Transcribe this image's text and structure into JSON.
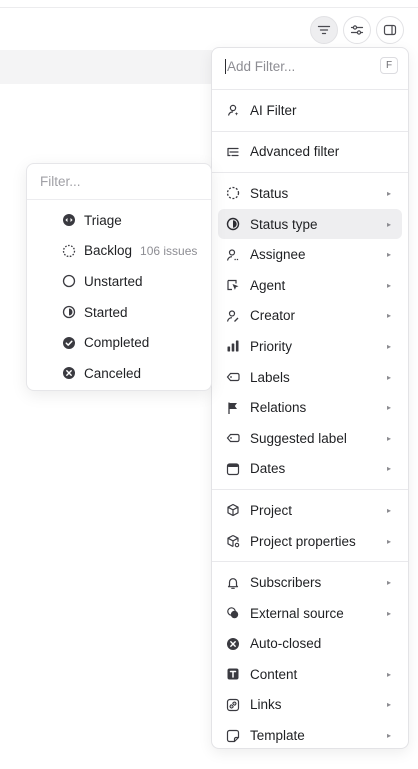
{
  "menu": {
    "search_placeholder": "Add Filter...",
    "search_shortcut": "F",
    "ai_filter": "AI Filter",
    "advanced_filter": "Advanced filter",
    "group1": [
      {
        "label": "Status"
      },
      {
        "label": "Status type"
      },
      {
        "label": "Assignee"
      },
      {
        "label": "Agent"
      },
      {
        "label": "Creator"
      },
      {
        "label": "Priority"
      },
      {
        "label": "Labels"
      },
      {
        "label": "Relations"
      },
      {
        "label": "Suggested label"
      },
      {
        "label": "Dates"
      }
    ],
    "group2": [
      {
        "label": "Project"
      },
      {
        "label": "Project properties"
      }
    ],
    "group3": [
      {
        "label": "Subscribers"
      },
      {
        "label": "External source"
      },
      {
        "label": "Auto-closed"
      },
      {
        "label": "Content"
      },
      {
        "label": "Links"
      },
      {
        "label": "Template"
      }
    ]
  },
  "submenu": {
    "search_placeholder": "Filter...",
    "items": [
      {
        "label": "Triage",
        "count": ""
      },
      {
        "label": "Backlog",
        "count": "106 issues"
      },
      {
        "label": "Unstarted",
        "count": ""
      },
      {
        "label": "Started",
        "count": ""
      },
      {
        "label": "Completed",
        "count": ""
      },
      {
        "label": "Canceled",
        "count": ""
      }
    ]
  }
}
